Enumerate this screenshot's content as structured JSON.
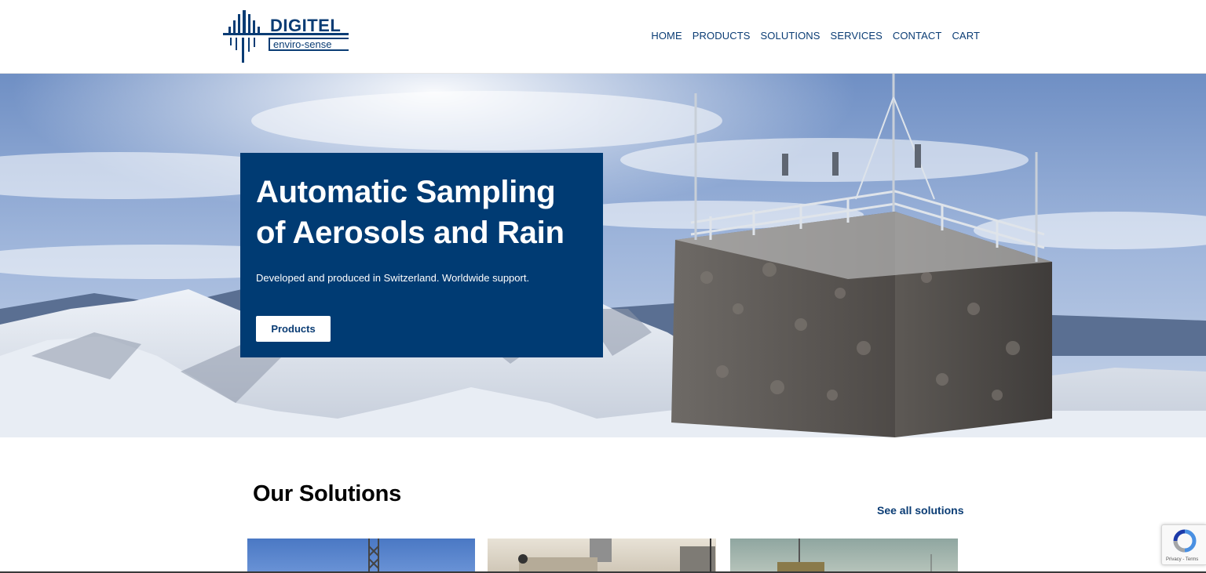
{
  "brand": {
    "name": "DIGITEL",
    "tagline": "enviro-sense",
    "color": "#0a3c74"
  },
  "nav": {
    "items": [
      {
        "label": "HOME"
      },
      {
        "label": "PRODUCTS"
      },
      {
        "label": "SOLUTIONS"
      },
      {
        "label": "SERVICES"
      },
      {
        "label": "CONTACT"
      },
      {
        "label": "CART"
      }
    ]
  },
  "hero": {
    "title_line1": "Automatic Sampling",
    "title_line2": "of Aerosols and Rain",
    "subtitle": "Developed and produced in Switzerland. Worldwide support.",
    "button_label": "Products",
    "card_color": "#003b73"
  },
  "solutions": {
    "title": "Our Solutions",
    "see_all_label": "See all solutions"
  },
  "recaptcha": {
    "terms": "Privacy - Terms"
  }
}
